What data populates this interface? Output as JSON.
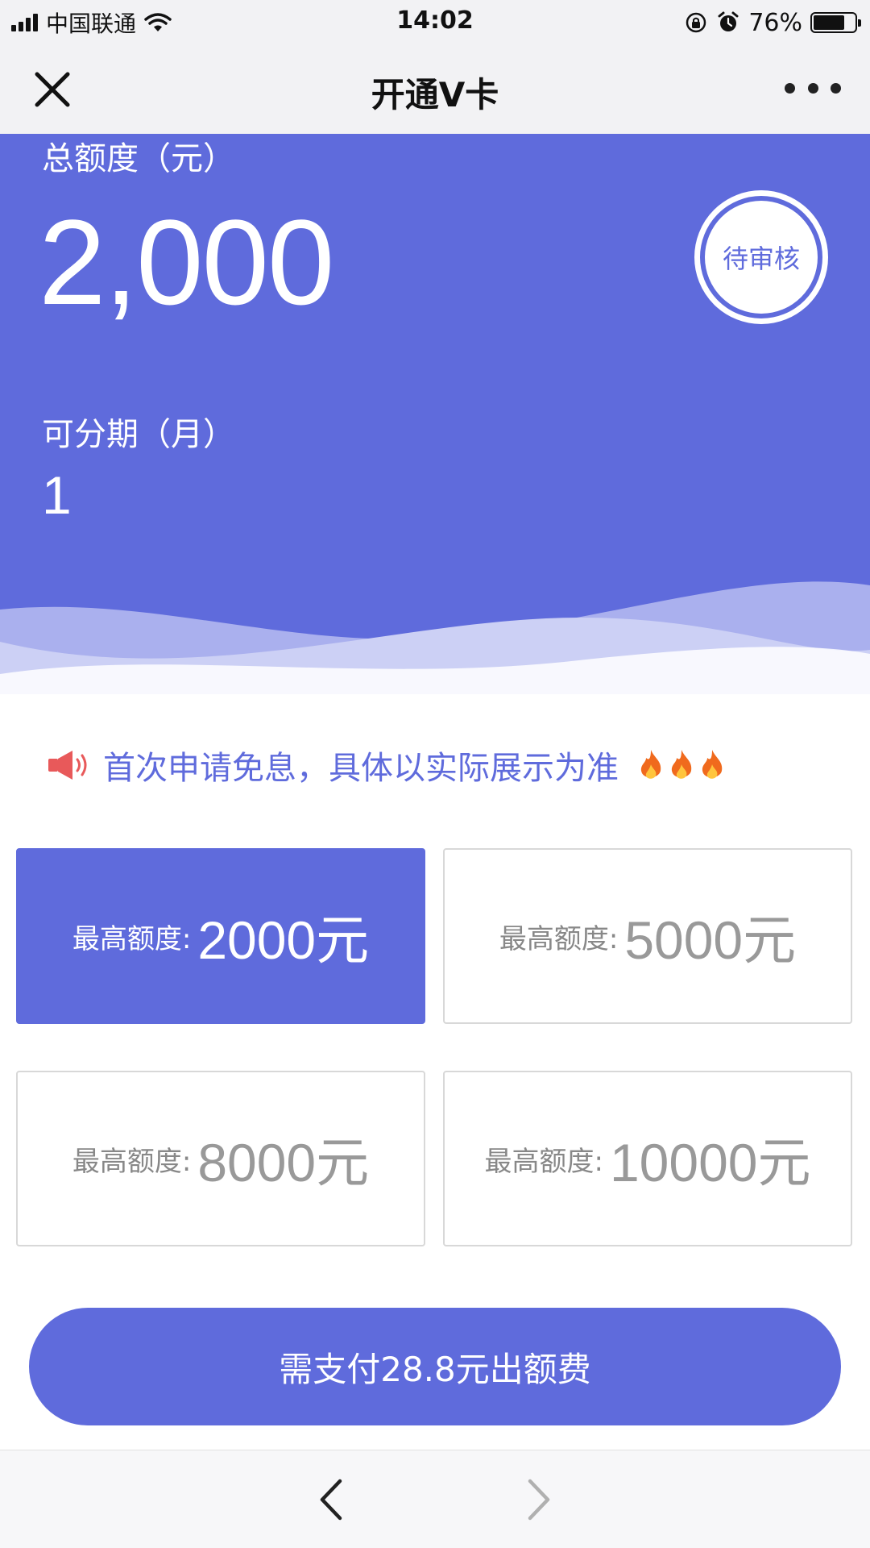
{
  "status_bar": {
    "carrier": "中国联通",
    "time": "14:02",
    "battery_percent": "76%",
    "battery_level": 0.76,
    "icons": [
      "signal-icon",
      "wifi-icon",
      "orientation-lock-icon",
      "alarm-icon",
      "battery-icon"
    ]
  },
  "nav": {
    "title": "开通V卡",
    "close_icon": "close-icon",
    "more_icon": "more-icon"
  },
  "hero": {
    "total_label": "总额度（元）",
    "total_amount": "2,000",
    "installment_label": "可分期（月）",
    "installment_months": "1",
    "status_stamp": "待审核",
    "background_color": "#5f6bdc"
  },
  "notice": {
    "icon": "megaphone-icon",
    "text": "首次申请免息，具体以实际展示为准",
    "decoration": "🔥🔥🔥"
  },
  "quota_options": [
    {
      "label": "最高额度:",
      "value": "2000元",
      "selected": true
    },
    {
      "label": "最高额度:",
      "value": "5000元",
      "selected": false
    },
    {
      "label": "最高额度:",
      "value": "8000元",
      "selected": false
    },
    {
      "label": "最高额度:",
      "value": "10000元",
      "selected": false
    }
  ],
  "pay_button": {
    "label": "需支付28.8元出额费"
  },
  "bottom_nav": {
    "back_icon": "chevron-left-icon",
    "forward_icon": "chevron-right-icon"
  },
  "colors": {
    "accent": "#5f6bdc",
    "muted_text": "#999999",
    "notice_icon": "#e8595a"
  }
}
